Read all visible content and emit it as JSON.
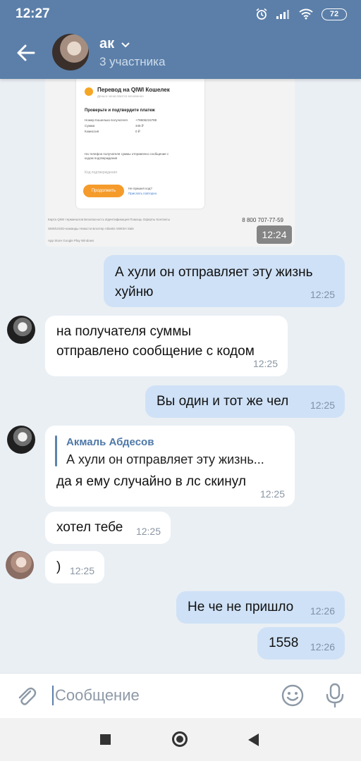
{
  "status": {
    "time": "12:27",
    "battery": "72"
  },
  "header": {
    "title": "ак",
    "subtitle": "3 участника"
  },
  "screenshot": {
    "title": "Перевод на QIWI Кошелек",
    "subtitle": "Деньги зачисляются мгновенно",
    "heading": "Проверьте и подтвердите платеж",
    "rows": [
      {
        "label": "Номер Кошелька получателя",
        "value": "+79606215788"
      },
      {
        "label": "Сумма",
        "value": "345 ₽"
      },
      {
        "label": "Комиссия",
        "value": "0 ₽"
      }
    ],
    "note": "На телефон получателя суммы отправлено сообщение с кодом подтверждения",
    "input_placeholder": "Код подтверждения",
    "button": "Продолжить",
    "help_q": "Не пришел код?",
    "help_link": "Прислать повторно",
    "footer_line1": "Карта QIWI терминалов   Безопасность   Идентификация   Помощь   Оферты   Контакты",
    "footer_line2": "SMS/USSD-команды   Новости   Блоггер   Atlantis   SWISH Sale",
    "footer_line3": "App Store   Google Play   Windows",
    "phone": "8 800 707-77-59",
    "time": "12:24"
  },
  "messages": [
    {
      "text_lines": [
        "А хули он отправляет эту жизнь",
        "хуйню"
      ],
      "time": "12:25"
    },
    {
      "text_lines": [
        "на получателя суммы",
        "отправлено сообщение с кодом"
      ],
      "time": "12:25"
    },
    {
      "text": "Вы один и тот же чел",
      "time": "12:25"
    },
    {
      "reply_author": "Акмаль Абдесов",
      "reply_text": "А хули он отправляет эту жизнь...",
      "text": "да я ему случайно в лс скинул",
      "time": "12:25"
    },
    {
      "text": "хотел тебе",
      "time": "12:25"
    },
    {
      "text": ")",
      "time": "12:25"
    },
    {
      "text": "Не че не пришло",
      "time": "12:26"
    },
    {
      "text": "1558",
      "time": "12:26"
    }
  ],
  "composer": {
    "placeholder": "Сообщение"
  },
  "colors": {
    "header": "#5b7fa9",
    "outgoing": "#cfe1f6",
    "incoming": "#ffffff",
    "background": "#eaeff4"
  }
}
